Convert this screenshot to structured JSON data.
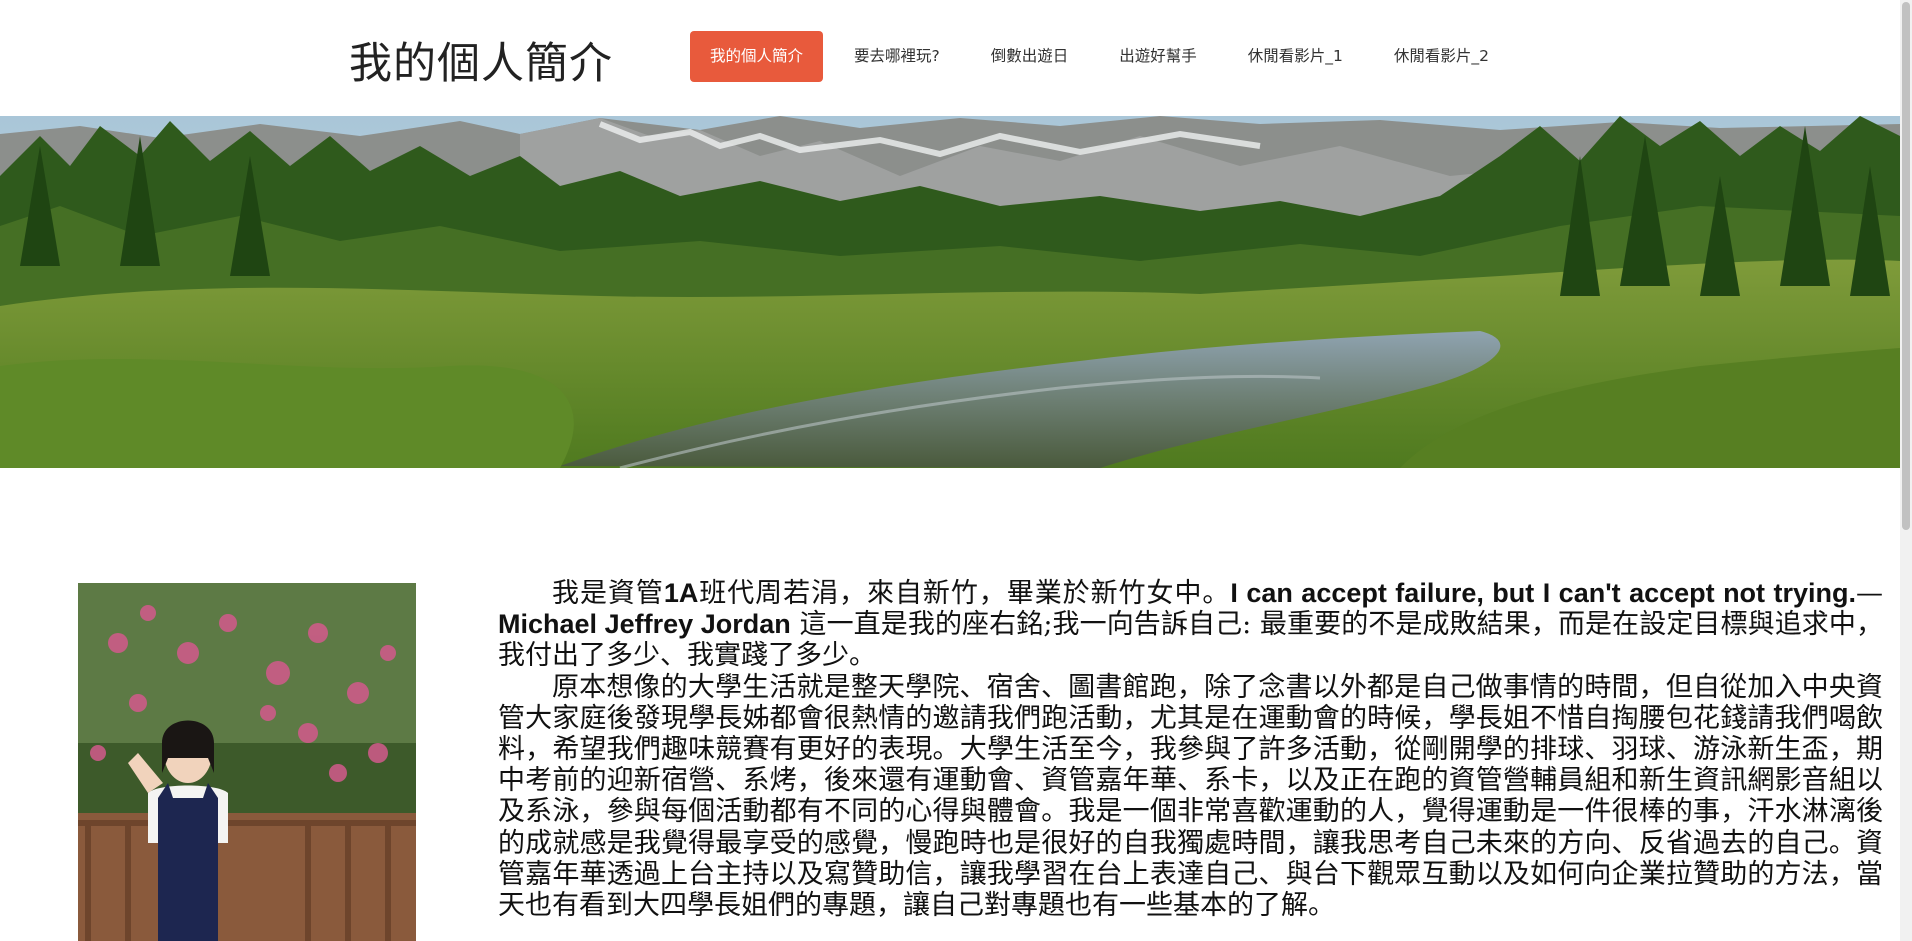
{
  "site": {
    "title": "我的個人簡介"
  },
  "nav": {
    "items": [
      {
        "label": "我的個人簡介",
        "active": true
      },
      {
        "label": "要去哪裡玩?",
        "active": false
      },
      {
        "label": "倒數出遊日",
        "active": false
      },
      {
        "label": "出遊好幫手",
        "active": false
      },
      {
        "label": "休閒看影片_1",
        "active": false
      },
      {
        "label": "休閒看影片_2",
        "active": false
      }
    ]
  },
  "colors": {
    "accent": "#e85a3c"
  },
  "intro": {
    "p1_a": "我是資管",
    "p1_class": "1A",
    "p1_b": "班代周若涓，來自新竹，畢業於新竹女中。",
    "quote": "I can accept failure, but I can't accept not trying.",
    "dash": "— ",
    "author": "Michael Jeffrey Jordan",
    "p1_c": " 這一直是我的座右銘;我一向告訴自己: 最重要的不是成敗結果，而是在設定目標與追求中，我付出了多少、我實踐了多少。",
    "p2": "原本想像的大學生活就是整天學院、宿舍、圖書館跑，除了念書以外都是自己做事情的時間，但自從加入中央資管大家庭後發現學長姊都會很熱情的邀請我們跑活動，尤其是在運動會的時候，學長姐不惜自掏腰包花錢請我們喝飲料，希望我們趣味競賽有更好的表現。大學生活至今，我參與了許多活動，從剛開學的排球、羽球、游泳新生盃，期中考前的迎新宿營、系烤，後來還有運動會、資管嘉年華、系卡，以及正在跑的資管營輔員組和新生資訊網影音組以及系泳，參與每個活動都有不同的心得與體會。我是一個非常喜歡運動的人，覺得運動是一件很棒的事，汗水淋漓後的成就感是我覺得最享受的感覺，慢跑時也是很好的自我獨處時間，讓我思考自己未來的方向、反省過去的自己。資管嘉年華透過上台主持以及寫贊助信，讓我學習在台上表達自己、與台下觀眾互動以及如何向企業拉贊助的方法，當天也有看到大四學長姐們的專題，讓自己對專題也有一些基本的了解。"
  },
  "images": {
    "banner": "mountain-lake-landscape",
    "photo": "portrait-under-blossom-tree"
  }
}
